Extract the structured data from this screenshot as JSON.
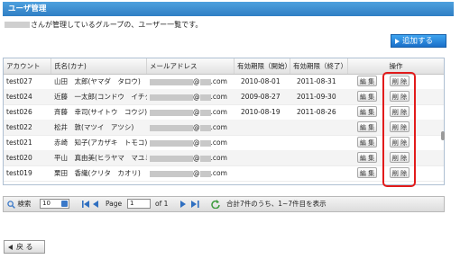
{
  "window": {
    "title": "ユーザ管理"
  },
  "description": "さんが管理しているグループの、ユーザー一覧です。",
  "add_button_label": "追加する",
  "columns": [
    "アカウント",
    "氏名(カナ)",
    "メールアドレス",
    "有効期限（開始）",
    "有効期限（終了）",
    "操作"
  ],
  "email_suffix": "@",
  "email_domain": ".com",
  "rows": [
    {
      "account": "test027",
      "name": "山田　太郎(ヤマダ　タロウ)",
      "start": "2010-08-01",
      "end": "2011-08-31"
    },
    {
      "account": "test024",
      "name": "近藤　一太郎(コンドウ　イチタ",
      "start": "2009-08-27",
      "end": "2011-09-30"
    },
    {
      "account": "test026",
      "name": "斉藤　幸司(サイトウ　コウジ)",
      "start": "2010-08-19",
      "end": "2011-08-26"
    },
    {
      "account": "test022",
      "name": "松井　敦(マツイ　アツシ)",
      "start": "",
      "end": ""
    },
    {
      "account": "test021",
      "name": "赤崎　知子(アカザキ　トモコ)",
      "start": "",
      "end": ""
    },
    {
      "account": "test020",
      "name": "平山　真由美(ヒラヤマ　マユミ",
      "start": "",
      "end": ""
    },
    {
      "account": "test019",
      "name": "栗田　香織(クリタ　カオリ)",
      "start": "",
      "end": ""
    }
  ],
  "edit_label": "編 集",
  "delete_label": "削 除",
  "pager": {
    "search_label": "検索",
    "page_size": "10",
    "page_label": "Page",
    "page_value": "1",
    "of_label": "of 1",
    "summary": "合計7件のうち、1~7件目を表示"
  },
  "back_label": "戻 る",
  "colors": {
    "accent": "#2f7fc4",
    "highlight": "#e21b1b"
  }
}
